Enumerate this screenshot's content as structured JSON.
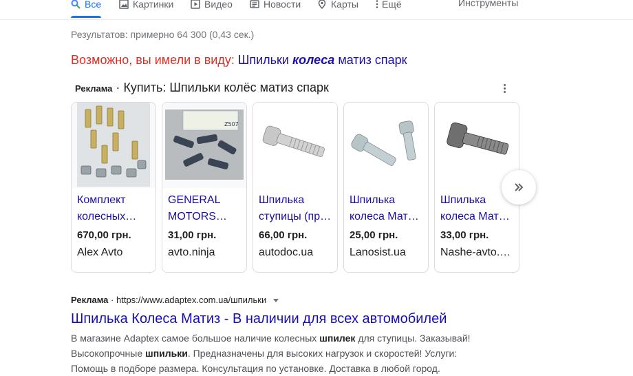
{
  "tabs": [
    {
      "label": "Все",
      "icon": "search-icon",
      "active": true
    },
    {
      "label": "Картинки",
      "icon": "image-icon"
    },
    {
      "label": "Видео",
      "icon": "video-icon"
    },
    {
      "label": "Новости",
      "icon": "news-icon"
    },
    {
      "label": "Карты",
      "icon": "map-pin-icon"
    },
    {
      "label": "Ещё",
      "icon": "more-vert-icon"
    }
  ],
  "tools_label": "Инструменты",
  "stats": "Результатов: примерно 64 300 (0,43 сек.)",
  "did_you_mean": {
    "prefix": "Возможно, вы имели в виду:",
    "word1": "Шпильки",
    "word_bold": "колеса",
    "rest": "матиз спарк"
  },
  "shopping": {
    "ad_label": "Реклама",
    "separator": "·",
    "title": "Купить: Шпильки колёс матиз спарк",
    "cards": [
      {
        "title_line1": "Комплект",
        "title_line2": "колесных…",
        "price": "670,00 грн.",
        "seller": "Alex Avto"
      },
      {
        "title_line1": "GENERAL",
        "title_line2": "MOTORS…",
        "price": "31,00 грн.",
        "seller": "avto.ninja"
      },
      {
        "title_line1": "Шпилька",
        "title_line2": "ступицы (пр…",
        "price": "66,00 грн.",
        "seller": "autodoc.ua"
      },
      {
        "title_line1": "Шпилька",
        "title_line2": "колеса Мат…",
        "price": "25,00 грн.",
        "seller": "Lanosist.ua"
      },
      {
        "title_line1": "Шпилька",
        "title_line2": "колеса Мат…",
        "price": "33,00 грн.",
        "seller": "Nashe-avto.…"
      }
    ]
  },
  "text_ad": {
    "label": "Реклама",
    "separator": "·",
    "url": "https://www.adaptex.com.ua/шпильки",
    "title": "Шпилька Колеса Матиз - В наличии для всех автомобилей",
    "desc_1": "В магазине Adaptex самое большое наличие колесных ",
    "desc_b1": "шпилек",
    "desc_2": " для ступицы. Заказывай!",
    "desc_3": "Высокопрочные ",
    "desc_b2": "шпильки",
    "desc_4": ". Предназначены для высоких нагрузок и скоростей! Услуги:",
    "desc_5": "Помощь в подборе размера. Консультация по установке. Доставка в любой город."
  },
  "colors": {
    "link": "#1a0dab",
    "accent": "#1a73e8",
    "suggest_red": "#d93025"
  }
}
